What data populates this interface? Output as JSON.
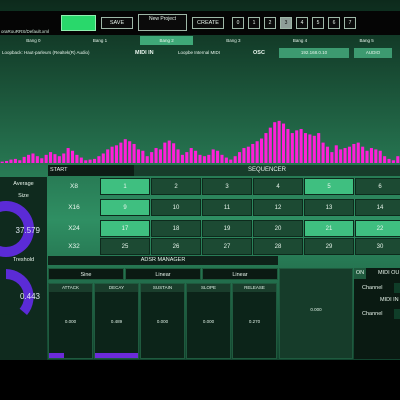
{
  "toolbar": {
    "path": "oraRouRRS/Default.xml",
    "save_label": "SAVE",
    "project_label": "New Project",
    "create_label": "CREATE",
    "slots": [
      "0",
      "1",
      "2",
      "3",
      "4",
      "5",
      "6",
      "7"
    ],
    "active_slot": "3"
  },
  "bangs": [
    "Bang 0",
    "Bang 1",
    "Bang 2",
    "Bang 3",
    "Bang 4",
    "Bang 5"
  ],
  "selected_bang": "Bang 2",
  "io": {
    "audio_device": "Loopback: Haut-parleurs (Realtek(R) Audio)",
    "midi_in_label": "MIDI IN",
    "midi_device": "Loopbe Internal MIDI",
    "osc_label": "OSC",
    "osc_address": "192.168.0.10",
    "audio_label": "AUDIO"
  },
  "spectrum": {
    "levels": [
      0.02,
      0.03,
      0.05,
      0.06,
      0.04,
      0.09,
      0.12,
      0.14,
      0.1,
      0.07,
      0.12,
      0.16,
      0.13,
      0.1,
      0.14,
      0.22,
      0.18,
      0.12,
      0.08,
      0.04,
      0.05,
      0.06,
      0.1,
      0.14,
      0.2,
      0.24,
      0.26,
      0.3,
      0.35,
      0.32,
      0.28,
      0.2,
      0.18,
      0.1,
      0.16,
      0.22,
      0.2,
      0.3,
      0.33,
      0.29,
      0.2,
      0.12,
      0.16,
      0.22,
      0.18,
      0.12,
      0.1,
      0.12,
      0.2,
      0.18,
      0.12,
      0.08,
      0.05,
      0.1,
      0.16,
      0.22,
      0.24,
      0.28,
      0.32,
      0.36,
      0.44,
      0.52,
      0.6,
      0.62,
      0.58,
      0.5,
      0.44,
      0.48,
      0.5,
      0.44,
      0.42,
      0.4,
      0.44,
      0.3,
      0.24,
      0.16,
      0.26,
      0.2,
      0.22,
      0.24,
      0.28,
      0.3,
      0.24,
      0.18,
      0.22,
      0.2,
      0.18,
      0.1,
      0.06,
      0.04,
      0.1
    ],
    "bar_color": "#ff1fd9"
  },
  "left": {
    "average_label": "Average",
    "size_label": "Size",
    "size_value": "37.579",
    "threshold_label": "Treshold",
    "threshold_value": "0.443",
    "knob_color": "#5b2bd6"
  },
  "sequencer": {
    "start_label": "START",
    "title": "SEQUENCER",
    "rows": [
      {
        "label": "X8",
        "cells": [
          {
            "n": "1",
            "on": true
          },
          {
            "n": "2",
            "on": false
          },
          {
            "n": "3",
            "on": false
          },
          {
            "n": "4",
            "on": false
          },
          {
            "n": "5",
            "on": true
          },
          {
            "n": "6",
            "on": false
          }
        ]
      },
      {
        "label": "X16",
        "cells": [
          {
            "n": "9",
            "on": true
          },
          {
            "n": "10",
            "on": false
          },
          {
            "n": "11",
            "on": false
          },
          {
            "n": "12",
            "on": false
          },
          {
            "n": "13",
            "on": false
          },
          {
            "n": "14",
            "on": false
          }
        ]
      },
      {
        "label": "X24",
        "cells": [
          {
            "n": "17",
            "on": true
          },
          {
            "n": "18",
            "on": false
          },
          {
            "n": "19",
            "on": false
          },
          {
            "n": "20",
            "on": false
          },
          {
            "n": "21",
            "on": true
          },
          {
            "n": "22",
            "on": true
          }
        ]
      },
      {
        "label": "X32",
        "cells": [
          {
            "n": "25",
            "on": false
          },
          {
            "n": "26",
            "on": false
          },
          {
            "n": "27",
            "on": false
          },
          {
            "n": "28",
            "on": false
          },
          {
            "n": "29",
            "on": false
          },
          {
            "n": "30",
            "on": false
          }
        ]
      }
    ]
  },
  "adsr": {
    "title": "ADSR MANAGER",
    "curves": [
      "Sine",
      "Linear",
      "Linear"
    ],
    "params": [
      {
        "label": "ATTACK",
        "value": "0.000",
        "level": 0.35
      },
      {
        "label": "DECAY",
        "value": "0.489",
        "level": 1.0
      },
      {
        "label": "SUSTAIN",
        "value": "0.000",
        "level": 0.0
      },
      {
        "label": "SLOPE",
        "value": "0.000",
        "level": 0.0
      },
      {
        "label": "RELEASE",
        "value": "0.270",
        "level": 0.0
      }
    ],
    "center_value": "0.000"
  },
  "midi": {
    "on_label": "ON",
    "out_label": "MIDI OU",
    "out_channel_label": "Channel",
    "in_label": "MIDI IN",
    "in_channel_label": "Channel"
  }
}
